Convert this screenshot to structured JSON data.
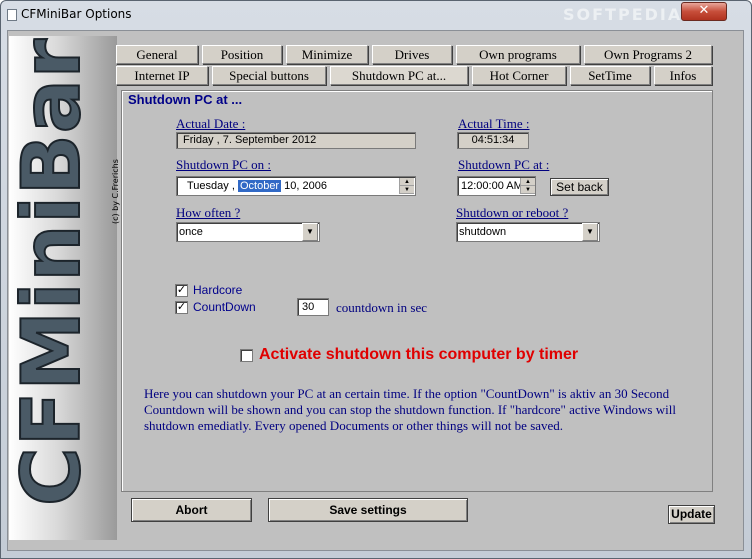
{
  "window": {
    "title": "CFMiniBar Options",
    "watermark": "SOFTPEDIA"
  },
  "logo": {
    "text": "CFMiniBar",
    "copyright": "(c) by C.Frerichs"
  },
  "tabs_row1": [
    "General",
    "Position",
    "Minimize",
    "Drives",
    "Own programs",
    "Own Programs 2"
  ],
  "tabs_row2": [
    "Internet IP",
    "Special buttons",
    "Shutdown PC at...",
    "Hot Corner",
    "SetTime",
    "Infos"
  ],
  "panel": {
    "title": "Shutdown PC at ...",
    "actual_date_label": "Actual Date :",
    "actual_date_value": "Friday  ,  7. September 2012",
    "actual_time_label": "Actual Time :",
    "actual_time_value": "04:51:34",
    "shutdown_on_label": "Shutdown PC on :",
    "shutdown_on_day": "Tuesday  ,",
    "shutdown_on_month": "October",
    "shutdown_on_rest": "10, 2006",
    "shutdown_at_label": "Shutdown PC at :",
    "shutdown_at_value": "12:00:00 AM",
    "set_back_label": "Set back",
    "how_often_label": "How often ?",
    "how_often_value": "once",
    "shutdown_or_reboot_label": "Shutdown or reboot ?",
    "shutdown_or_reboot_value": "shutdown",
    "hardcore_label": "Hardcore",
    "countdown_label": "CountDown",
    "countdown_value": "30",
    "countdown_unit": "countdown in sec",
    "activate_label": "Activate shutdown this computer by timer",
    "description": "Here you can shutdown your PC at an certain time. If the option \"CountDown\" is aktiv an 30 Second Countdown will be shown and you can stop the shutdown function. If \"hardcore\" active Windows will shutdown emediatly. Every opened Documents or other things will not be saved."
  },
  "bottom": {
    "abort_label": "Abort",
    "save_label": "Save settings",
    "update_label": "Update"
  },
  "colors": {
    "label_blue": "#00007f",
    "activate_red": "#e00000",
    "selection": "#3169c6"
  }
}
